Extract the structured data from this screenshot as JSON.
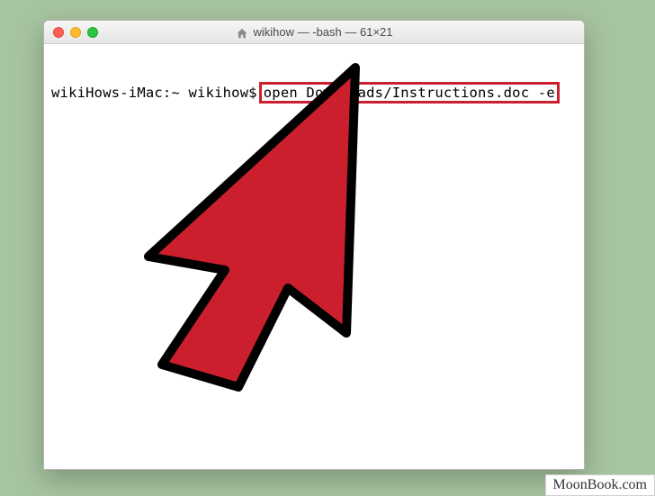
{
  "window": {
    "title": "wikihow — -bash — 61×21"
  },
  "terminal": {
    "prompt": "wikiHows-iMac:~ wikihow$",
    "command": "open Downloads/Instructions.doc -e"
  },
  "icons": {
    "home": "home-icon",
    "close": "close-icon",
    "minimize": "minimize-icon",
    "zoom": "zoom-icon",
    "cursor": "cursor-arrow"
  },
  "watermark": "MoonBook.com"
}
